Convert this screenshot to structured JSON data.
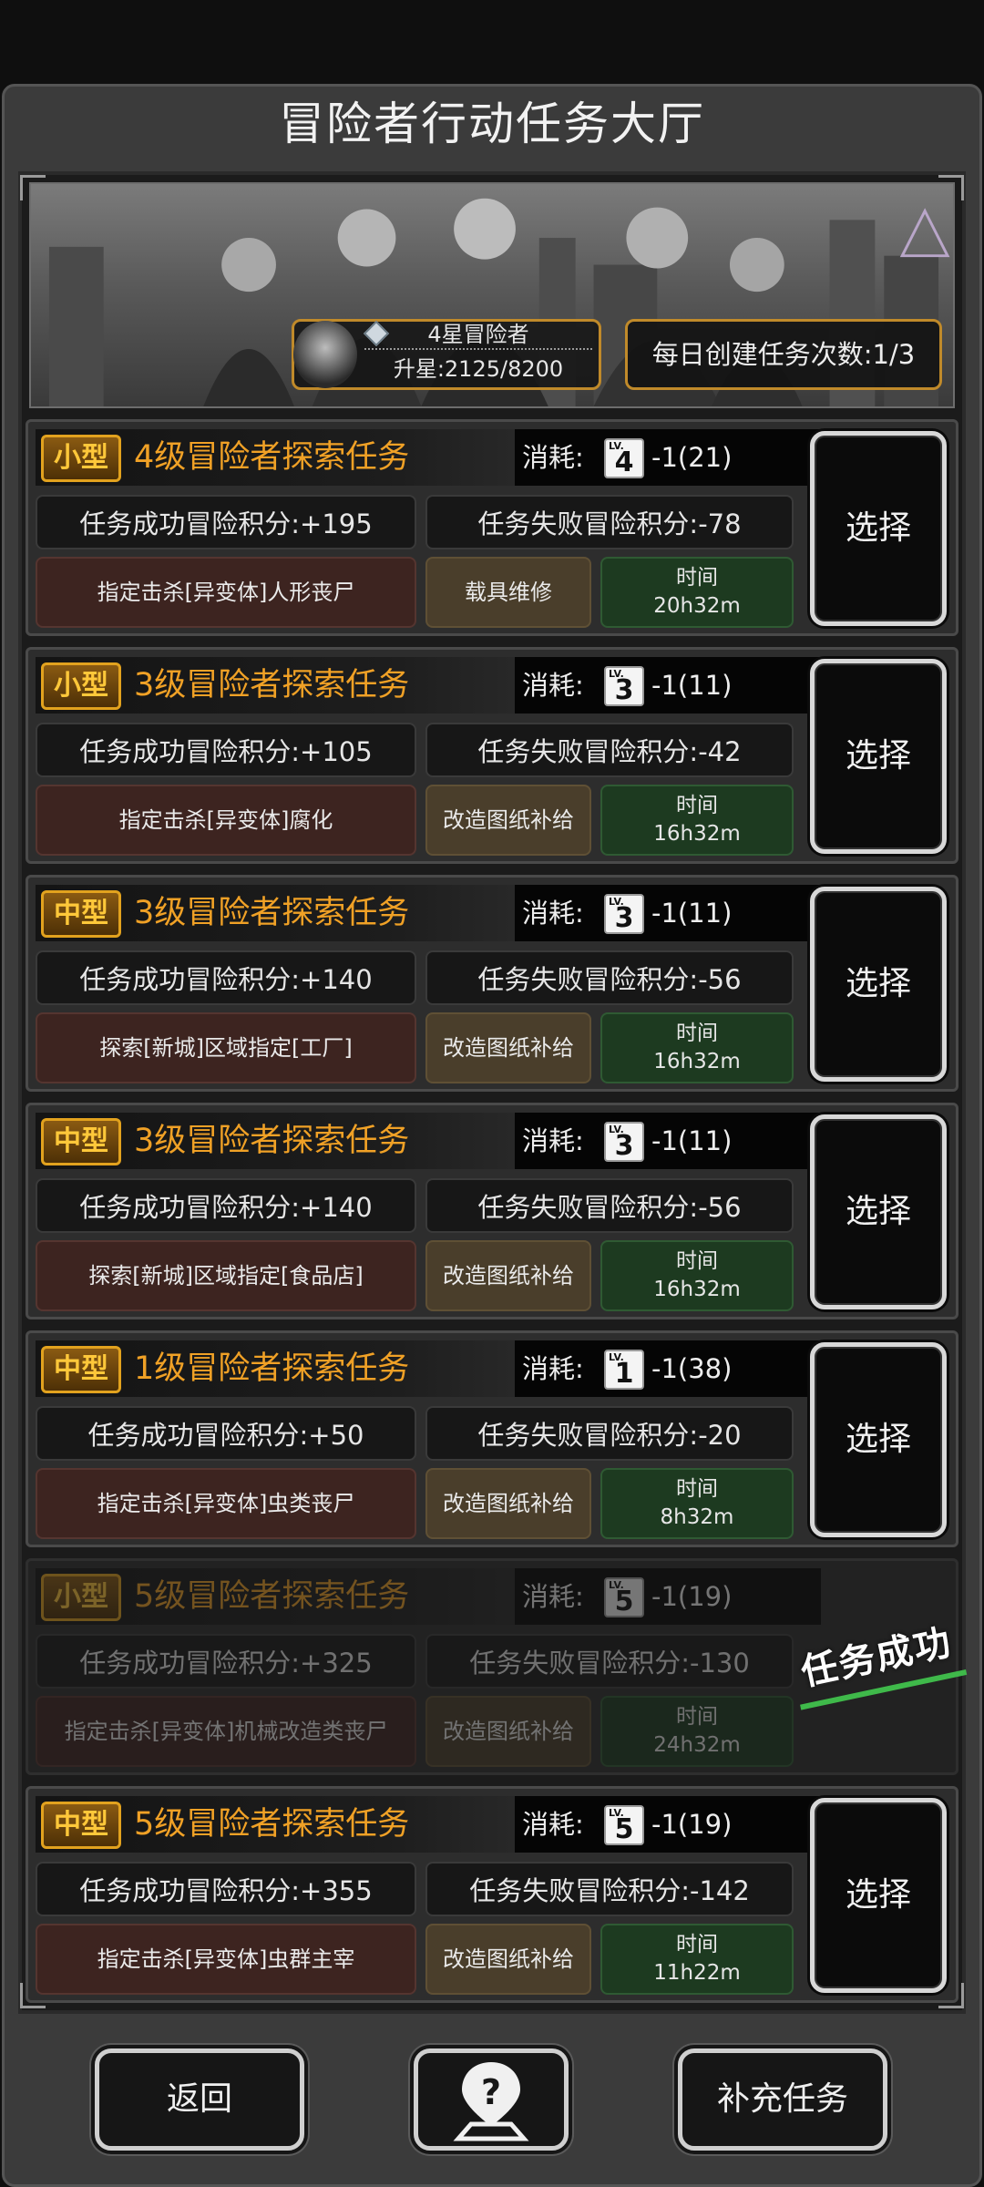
{
  "header": {
    "title": "冒险者行动任务大厅"
  },
  "banner": {
    "rank_title": "4星冒险者",
    "rank_progress": "升星:2125/8200",
    "daily_create": "每日创建任务次数:1/3"
  },
  "cost_label": "消耗:",
  "select_label": "选择",
  "tasks": [
    {
      "size": "小型",
      "name": "4级冒险者探索任务",
      "level": "4",
      "cost": "-1(21)",
      "success": "任务成功冒险积分:+195",
      "fail": "任务失败冒险积分:-78",
      "target": "指定击杀[异变体]人形丧尸",
      "reward": "载具维修",
      "time_label": "时间",
      "time": "20h32m"
    },
    {
      "size": "小型",
      "name": "3级冒险者探索任务",
      "level": "3",
      "cost": "-1(11)",
      "success": "任务成功冒险积分:+105",
      "fail": "任务失败冒险积分:-42",
      "target": "指定击杀[异变体]腐化",
      "reward": "改造图纸补给",
      "time_label": "时间",
      "time": "16h32m"
    },
    {
      "size": "中型",
      "name": "3级冒险者探索任务",
      "level": "3",
      "cost": "-1(11)",
      "success": "任务成功冒险积分:+140",
      "fail": "任务失败冒险积分:-56",
      "target": "探索[新城]区域指定[工厂]",
      "reward": "改造图纸补给",
      "time_label": "时间",
      "time": "16h32m"
    },
    {
      "size": "中型",
      "name": "3级冒险者探索任务",
      "level": "3",
      "cost": "-1(11)",
      "success": "任务成功冒险积分:+140",
      "fail": "任务失败冒险积分:-56",
      "target": "探索[新城]区域指定[食品店]",
      "reward": "改造图纸补给",
      "time_label": "时间",
      "time": "16h32m"
    },
    {
      "size": "中型",
      "name": "1级冒险者探索任务",
      "level": "1",
      "cost": "-1(38)",
      "success": "任务成功冒险积分:+50",
      "fail": "任务失败冒险积分:-20",
      "target": "指定击杀[异变体]虫类丧尸",
      "reward": "改造图纸补给",
      "time_label": "时间",
      "time": "8h32m"
    },
    {
      "size": "小型",
      "name": "5级冒险者探索任务",
      "level": "5",
      "cost": "-1(19)",
      "success": "任务成功冒险积分:+325",
      "fail": "任务失败冒险积分:-130",
      "target": "指定击杀[异变体]机械改造类丧尸",
      "reward": "改造图纸补给",
      "time_label": "时间",
      "time": "24h32m",
      "status": "任务成功"
    },
    {
      "size": "中型",
      "name": "5级冒险者探索任务",
      "level": "5",
      "cost": "-1(19)",
      "success": "任务成功冒险积分:+355",
      "fail": "任务失败冒险积分:-142",
      "target": "指定击杀[异变体]虫群主宰",
      "reward": "改造图纸补给",
      "time_label": "时间",
      "time": "11h22m"
    }
  ],
  "footer": {
    "back": "返回",
    "help_icon": "question-map-pin-icon",
    "refill": "补充任务"
  },
  "colors": {
    "accent_orange": "#f0a126",
    "success_green": "#3fb94a",
    "badge_gold": "#e2a21e"
  }
}
